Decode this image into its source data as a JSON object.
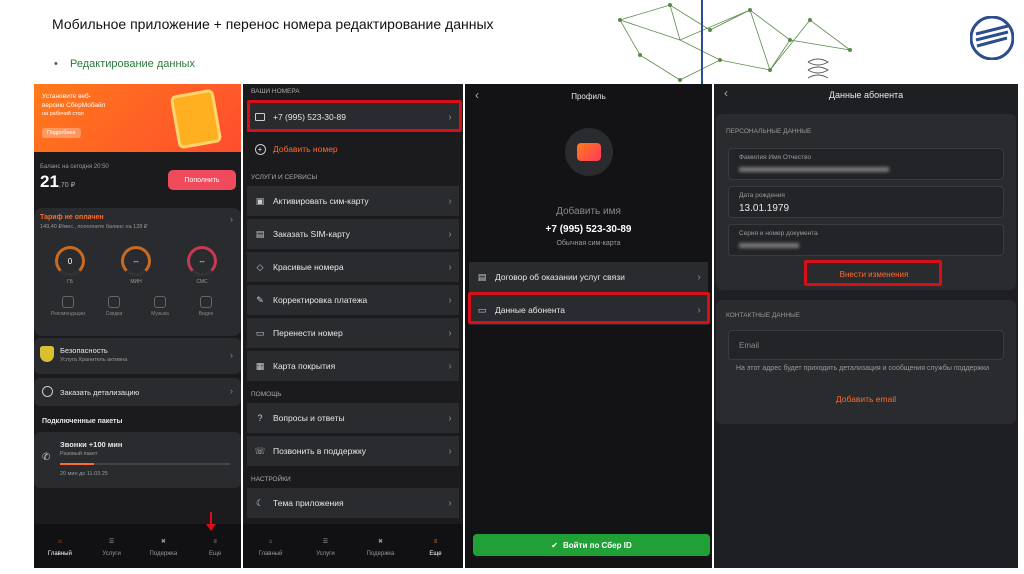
{
  "slide": {
    "title": "Мобильное приложение + перенос номера редактирование данных",
    "bullet": "Редактирование данных"
  },
  "screen_home": {
    "promo": {
      "line1": "Установите веб-",
      "line2": "версию СберМобайл",
      "line3": "на рабочий стол",
      "button": "Подробнее"
    },
    "balance_label": "Баланс на сегодня 20:50",
    "balance_int": "21",
    "balance_frac": ",70 ₽",
    "topup_button": "Пополнить",
    "tariff": {
      "title": "Тариф не оплачен",
      "subtitle": "149,40 ₽/мес., пополните баланс на 128 ₽"
    },
    "counters": [
      {
        "value": "0",
        "unit": "ГБ",
        "color": "#c96a22"
      },
      {
        "value": "--",
        "unit": "МИН",
        "color": "#c96a22"
      },
      {
        "value": "--",
        "unit": "СМС",
        "color": "#c43b52"
      }
    ],
    "services": [
      "Рекомендации",
      "Скидки",
      "Музыка",
      "Видео"
    ],
    "security": {
      "title": "Безопасность",
      "subtitle": "Услуга Хранитель активна"
    },
    "detail": "Заказать детализацию",
    "packages_header": "Подключенные пакеты",
    "package": {
      "title": "Звонки +100 мин",
      "subtitle": "Разовый пакет",
      "footer": "20 мин до 11.03.25",
      "progress": 0.2
    }
  },
  "screen_menu": {
    "section_numbers": "ВАШИ НОМЕРА",
    "phone": "+7 (995) 523-30-89",
    "add_number": "Добавить номер",
    "section_services": "УСЛУГИ И СЕРВИСЫ",
    "services": [
      "Активировать сим-карту",
      "Заказать SIM-карту",
      "Красивые номера",
      "Корректировка платежа",
      "Перенести номер",
      "Карта покрытия"
    ],
    "section_help": "ПОМОЩЬ",
    "help": [
      "Вопросы и ответы",
      "Позвонить в поддержку"
    ],
    "section_settings": "НАСТРОЙКИ",
    "settings": [
      "Тема приложения"
    ]
  },
  "tabs": [
    "Главный",
    "Услуги",
    "Подержка",
    "Еще"
  ],
  "screen_profile": {
    "title": "Профиль",
    "add_name": "Добавить имя",
    "phone": "+7 (995) 523-30-89",
    "sim_type": "Обычная сим-карта",
    "items": [
      "Договор об оказании услуг связи",
      "Данные абонента"
    ],
    "sber_button": "Войти по Сбер ID"
  },
  "screen_subscriber": {
    "title": "Данные абонента",
    "personal_header": "ПЕРСОНАЛЬНЫЕ ДАННЫЕ",
    "field_name_label": "Фамилия Имя Отчество",
    "field_birth_label": "Дата рождения",
    "field_birth_value": "13.01.1979",
    "field_doc_label": "Серия и номер документа",
    "edit_button": "Внести изменения",
    "contact_header": "КОНТАКТНЫЕ ДАННЫЕ",
    "email_placeholder": "Email",
    "email_hint": "На этот адрес будет приходить детализация и сообщения службы поддержки",
    "add_email": "Добавить email"
  },
  "colors": {
    "accent": "#ff6b2c",
    "highlight": "#d80f17",
    "sber_green": "#21a038",
    "panel_bg": "#1b1b1d"
  }
}
